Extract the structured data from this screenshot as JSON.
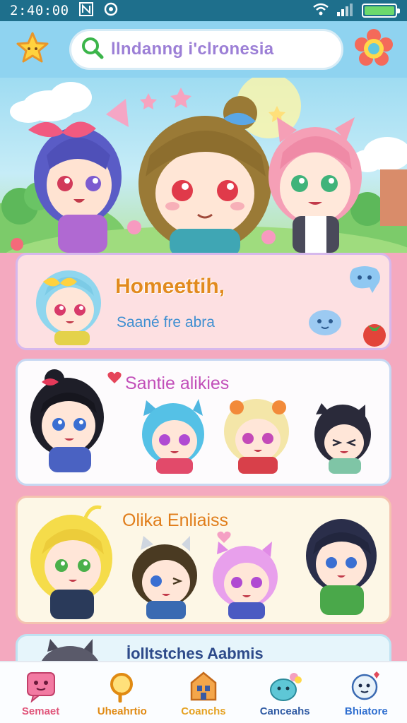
{
  "status_bar": {
    "time": "2:40:00"
  },
  "header": {
    "search_text": "llndanng i'clronesia"
  },
  "cards": [
    {
      "title": "Homeettih,",
      "subtitle": "Saané fre abra"
    },
    {
      "title": "Santie alikies"
    },
    {
      "title": "Olika Enliaiss"
    },
    {
      "title": "İolltstches Aabmis"
    }
  ],
  "bottom_nav": [
    {
      "label": "Semaet",
      "color": "#e0557a",
      "icon": "chat-face-icon"
    },
    {
      "label": "Uheahrtio",
      "color": "#e08a12",
      "icon": "search-icon"
    },
    {
      "label": "Coanchs",
      "color": "#e5a222",
      "icon": "house-icon"
    },
    {
      "label": "Canceahs",
      "color": "#2f5aa3",
      "icon": "blob-character-icon"
    },
    {
      "label": "Bhiatore",
      "color": "#2f6fd0",
      "icon": "ghost-face-icon"
    }
  ]
}
